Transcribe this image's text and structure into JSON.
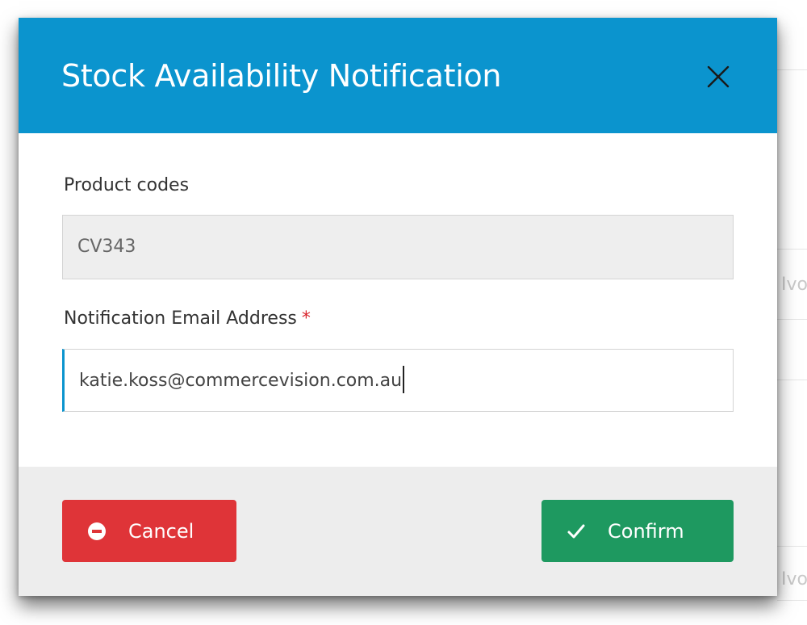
{
  "background": {
    "fragment_1": "Ivo",
    "fragment_2": "Ivo"
  },
  "modal": {
    "title": "Stock Availability Notification",
    "close_icon": "close-icon",
    "header_color": "#0b94ce"
  },
  "form": {
    "product_codes": {
      "label": "Product codes",
      "value": "CV343"
    },
    "email": {
      "label": "Notification Email Address",
      "required_marker": "*",
      "value": "katie.koss@commercevision.com.au"
    }
  },
  "footer": {
    "cancel": {
      "label": "Cancel",
      "icon": "minus-circle-icon",
      "color": "#df3438"
    },
    "confirm": {
      "label": "Confirm",
      "icon": "check-icon",
      "color": "#1e9960"
    }
  }
}
